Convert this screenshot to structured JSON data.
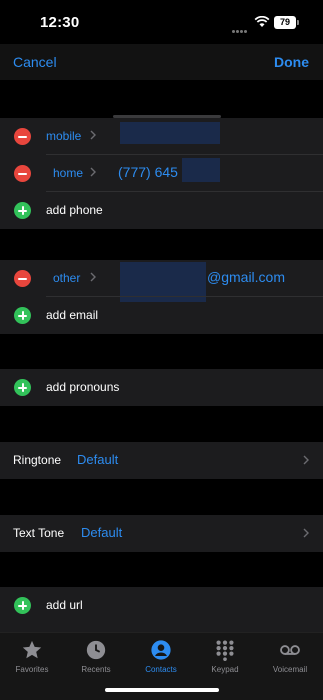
{
  "status_bar": {
    "time": "12:30",
    "battery": "79"
  },
  "nav": {
    "cancel_label": "Cancel",
    "done_label": "Done"
  },
  "phone_section": {
    "rows": [
      {
        "type": "remove",
        "label": "mobile",
        "value": ""
      },
      {
        "type": "remove",
        "label": "home",
        "value": "(777) 645"
      },
      {
        "type": "add",
        "text": "add phone"
      }
    ]
  },
  "email_section": {
    "rows": [
      {
        "type": "remove",
        "label": "other",
        "value": "@gmail.com"
      },
      {
        "type": "add",
        "text": "add email"
      }
    ]
  },
  "pronouns_section": {
    "add_text": "add pronouns"
  },
  "ringtone": {
    "label": "Ringtone",
    "value": "Default"
  },
  "text_tone": {
    "label": "Text Tone",
    "value": "Default"
  },
  "url_section": {
    "add_text": "add url"
  },
  "tab_bar": {
    "tabs": [
      {
        "label": "Favorites",
        "icon": "star-icon",
        "active": false
      },
      {
        "label": "Recents",
        "icon": "clock-icon",
        "active": false
      },
      {
        "label": "Contacts",
        "icon": "person-circle-icon",
        "active": true
      },
      {
        "label": "Keypad",
        "icon": "keypad-icon",
        "active": false
      },
      {
        "label": "Voicemail",
        "icon": "voicemail-icon",
        "active": false
      }
    ]
  },
  "colors": {
    "accent": "#2d8cf0",
    "remove": "#e8463d",
    "add": "#32c25a",
    "cell": "#1c1c1e",
    "background": "#000000"
  }
}
